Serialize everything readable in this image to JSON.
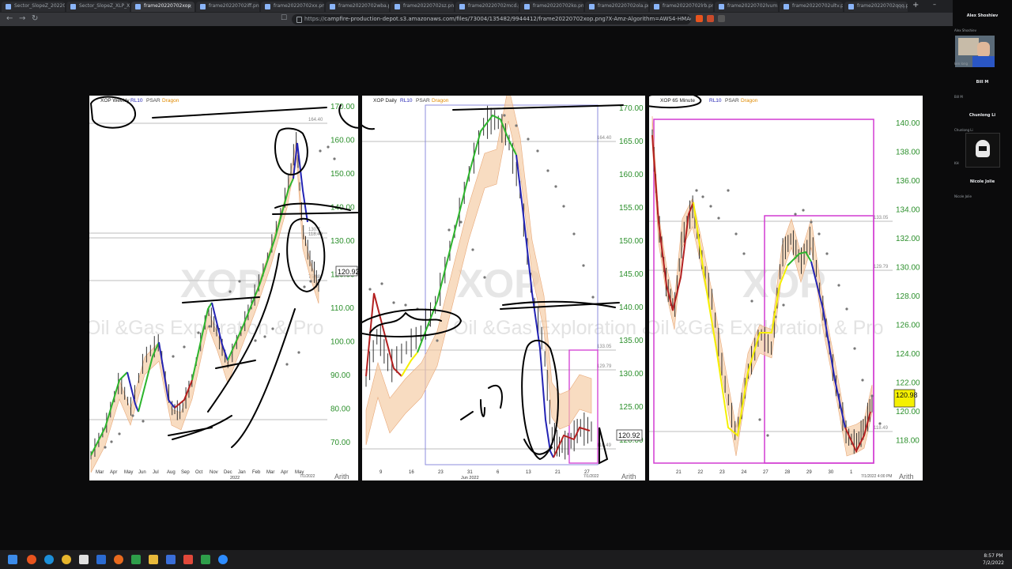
{
  "browser": {
    "tabs": [
      {
        "label": "Sector_SlopeZ_2022070",
        "active": false
      },
      {
        "label": "Sector_SlopeZ_XLP_XLY",
        "active": false
      },
      {
        "label": "frame20220702xop",
        "active": true
      },
      {
        "label": "frame20220702iff.png",
        "active": false
      },
      {
        "label": "frame20220702xx.png",
        "active": false
      },
      {
        "label": "frame20220702wba.png",
        "active": false
      },
      {
        "label": "frame20220702sz.png",
        "active": false
      },
      {
        "label": "frame20220702mcd.png",
        "active": false
      },
      {
        "label": "frame20220702ko.png",
        "active": false
      },
      {
        "label": "frame20220702ola.png",
        "active": false
      },
      {
        "label": "frame20220702lrb.png",
        "active": false
      },
      {
        "label": "frame20220702lvum.png",
        "active": false
      },
      {
        "label": "frame20220702ultv.png",
        "active": false
      },
      {
        "label": "frame20220702qqq.png",
        "active": false
      }
    ],
    "new_tab": "+",
    "url_scheme": "https://",
    "url": "campfire-production-depot.s3.amazonaws.com/files/73004/135482/9944412/frame20220702xop.png?X-Amz-Algorithm=AWS4-HMAC-SHA25..."
  },
  "charts": {
    "weekly": {
      "header": "XOP Weekly",
      "rl": "RL10",
      "psar": "PSAR",
      "dragon": "Dragon",
      "watermark": "XOP",
      "watermark_sub": "Oil &Gas Exploration & Pro",
      "y_ticks": [
        "170.00",
        "160.00",
        "150.00",
        "140.00",
        "130.00",
        "120.00",
        "110.00",
        "100.00",
        "90.00",
        "80.00",
        "70.00"
      ],
      "ref_labels": [
        "164.40",
        "130.7",
        "118.49",
        "75.88"
      ],
      "price": "120.92",
      "x_ticks": [
        "Mar",
        "Apr",
        "May",
        "Jun",
        "Jul",
        "Aug",
        "Sep",
        "Oct",
        "Nov",
        "Dec",
        "Jan",
        "Feb",
        "Mar",
        "Apr",
        "May"
      ],
      "year": "2022",
      "date": "7/1/2022",
      "scale": "Arith"
    },
    "daily": {
      "header": "XOP Daily",
      "rl": "RL10",
      "psar": "PSAR",
      "dragon": "Dragon",
      "watermark": "XOP",
      "watermark_sub": "Oil &Gas Exploration & Pro",
      "y_ticks": [
        "170.00",
        "165.00",
        "160.00",
        "155.00",
        "150.00",
        "145.00",
        "140.00",
        "135.00",
        "130.00",
        "125.00",
        "120.00"
      ],
      "ref_labels": [
        "164.40",
        "133.05",
        "129.79",
        "118.49"
      ],
      "price": "120.92",
      "x_ticks": [
        "9",
        "16",
        "23",
        "31",
        "6",
        "13",
        "21",
        "27"
      ],
      "year": "Jun 2022",
      "date": "7/1/2022",
      "scale": "Arith"
    },
    "minute": {
      "header": "XOP 65 Minute",
      "rl": "RL10",
      "psar": "PSAR",
      "dragon": "Dragon",
      "watermark": "XOP",
      "watermark_sub": "Oil &Gas Exploration & Pro",
      "y_ticks": [
        "140.00",
        "138.00",
        "136.00",
        "134.00",
        "132.00",
        "130.00",
        "128.00",
        "126.00",
        "124.00",
        "122.00",
        "120.00",
        "118.00"
      ],
      "ref_labels": [
        "133.05",
        "129.79",
        "118.49"
      ],
      "price": "120.98",
      "x_ticks": [
        "21",
        "22",
        "23",
        "24",
        "27",
        "28",
        "29",
        "30",
        "1"
      ],
      "date": "7/1/2022 4:00 PM",
      "scale": "Arith"
    },
    "annotation": "-15"
  },
  "participants": [
    {
      "name": "Alex Shoshiev",
      "sub": "Alex Shoshiev"
    },
    {
      "name": "",
      "sub": "ken long"
    },
    {
      "name": "Bill M",
      "sub": "Bill M"
    },
    {
      "name": "Chunlong Li",
      "sub": "Chunlong Li"
    },
    {
      "name": "",
      "sub": "KH"
    },
    {
      "name": "Nicole Jolie",
      "sub": "Nicole Jolie"
    }
  ],
  "taskbar": {
    "time": "8:57 PM",
    "date": "7/2/2022"
  },
  "colors": {
    "up": "#2db52d",
    "down": "#2323b4",
    "red": "#b32020",
    "yellow": "#f5f000",
    "band": "#f5c9a0",
    "psar": "#777777",
    "price_box": "#f5f000",
    "magenta": "#d23cd2",
    "purple": "#8c8cdc",
    "axis": "#2b8f2b"
  }
}
